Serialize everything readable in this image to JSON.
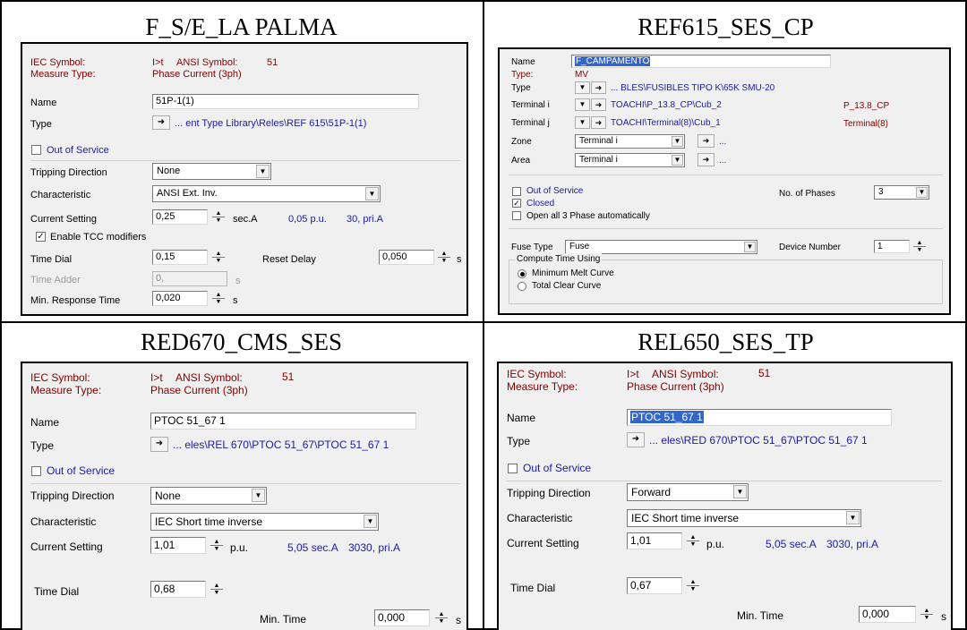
{
  "titles": {
    "q1": "F_S/E_LA PALMA",
    "q2": "REF615_SES_CP",
    "q3": "RED670_CMS_SES",
    "q4": "REL650_SES_TP"
  },
  "panel1": {
    "iec_label": "IEC Symbol:",
    "iec_value": "I>t",
    "ansi_label": "ANSI Symbol:",
    "ansi_value": "51",
    "measure_label": "Measure Type:",
    "measure_value": "Phase Current (3ph)",
    "name_label": "Name",
    "name_value": "51P-1(1)",
    "type_label": "Type",
    "type_value": "... ent Type Library\\Reles\\REF 615\\51P-1(1)",
    "out_of_service": "Out of Service",
    "tripping_label": "Tripping Direction",
    "tripping_value": "None",
    "characteristic_label": "Characteristic",
    "characteristic_value": "ANSI Ext. Inv.",
    "current_label": "Current Setting",
    "current_value": "0,25",
    "current_unit": "sec.A",
    "current_pu": "0,05 p.u.",
    "current_pri": "30, pri.A",
    "tcc_label": "Enable TCC modifiers",
    "time_dial_label": "Time Dial",
    "time_dial_value": "0,15",
    "reset_delay_label": "Reset Delay",
    "reset_delay_value": "0,050",
    "reset_unit": "s",
    "time_adder_label": "Time Adder",
    "time_adder_value": "0,",
    "time_adder_unit": "s",
    "min_resp_label": "Min. Response Time",
    "min_resp_value": "0,020",
    "min_resp_unit": "s"
  },
  "panel2": {
    "name_label": "Name",
    "name_value": "F_CAMPAMENTO",
    "type_label_1": "Type:",
    "type_value_1": "MV",
    "type_label_2": "Type",
    "type_value_2": "... BLES\\FUSIBLES TIPO K\\65K SMU-20",
    "term_i_label": "Terminal i",
    "term_i_value": "TOACHI\\P_13.8_CP\\Cub_2",
    "term_i_right": "P_13.8_CP",
    "term_j_label": "Terminal j",
    "term_j_value": "TOACHI\\Terminal(8)\\Cub_1",
    "term_j_right": "Terminal(8)",
    "zone_label": "Zone",
    "zone_value": "Terminal i",
    "area_label": "Area",
    "area_value": "Terminal i",
    "ellipsis": "...",
    "out_of_service": "Out of Service",
    "closed": "Closed",
    "open_all": "Open all 3 Phase automatically",
    "phases_label": "No. of Phases",
    "phases_value": "3",
    "fuse_type_label": "Fuse Type",
    "fuse_type_value": "Fuse",
    "device_number_label": "Device Number",
    "device_number_value": "1",
    "compute_label": "Compute Time Using",
    "radio_1": "Minimum Melt Curve",
    "radio_2": "Total Clear Curve"
  },
  "panel3": {
    "iec_label": "IEC Symbol:",
    "iec_value": "I>t",
    "ansi_label": "ANSI Symbol:",
    "ansi_value": "51",
    "measure_label": "Measure Type:",
    "measure_value": "Phase Current (3ph)",
    "name_label": "Name",
    "name_value": "PTOC 51_67 1",
    "type_label": "Type",
    "type_value": "... eles\\REL 670\\PTOC 51_67\\PTOC 51_67 1",
    "out_of_service": "Out of Service",
    "tripping_label": "Tripping Direction",
    "tripping_value": "None",
    "characteristic_label": "Characteristic",
    "characteristic_value": "IEC Short time inverse",
    "current_label": "Current Setting",
    "current_value": "1,01",
    "current_unit": "p.u.",
    "current_sec": "5,05 sec.A",
    "current_pri": "3030, pri.A",
    "time_dial_label": "Time Dial",
    "time_dial_value": "0,68",
    "min_time_label": "Min. Time",
    "min_time_value": "0,000",
    "min_time_unit": "s"
  },
  "panel4": {
    "iec_label": "IEC Symbol:",
    "iec_value": "I>t",
    "ansi_label": "ANSI Symbol:",
    "ansi_value": "51",
    "measure_label": "Measure Type:",
    "measure_value": "Phase Current (3ph)",
    "name_label": "Name",
    "name_value": "PTOC 51_67 1",
    "type_label": "Type",
    "type_value": "... eles\\RED 670\\PTOC 51_67\\PTOC 51_67 1",
    "out_of_service": "Out of Service",
    "tripping_label": "Tripping Direction",
    "tripping_value": "Forward",
    "characteristic_label": "Characteristic",
    "characteristic_value": "IEC Short time inverse",
    "current_label": "Current Setting",
    "current_value": "1,01",
    "current_unit": "p.u.",
    "current_sec": "5,05 sec.A",
    "current_pri": "3030, pri.A",
    "time_dial_label": "Time Dial",
    "time_dial_value": "0,67",
    "min_time_label": "Min. Time",
    "min_time_value": "0,000",
    "min_time_unit": "s"
  },
  "colors": {
    "label_red": "#800000",
    "link_blue": "#1a1aa6",
    "dialog_bg": "#f0f0f0",
    "selection": "#3366cc"
  },
  "icons": {
    "arrow_button": "right-arrow-icon",
    "dropdown": "chevron-down-icon",
    "spinner": "spinner-icon",
    "checkbox": "checkbox-icon"
  }
}
